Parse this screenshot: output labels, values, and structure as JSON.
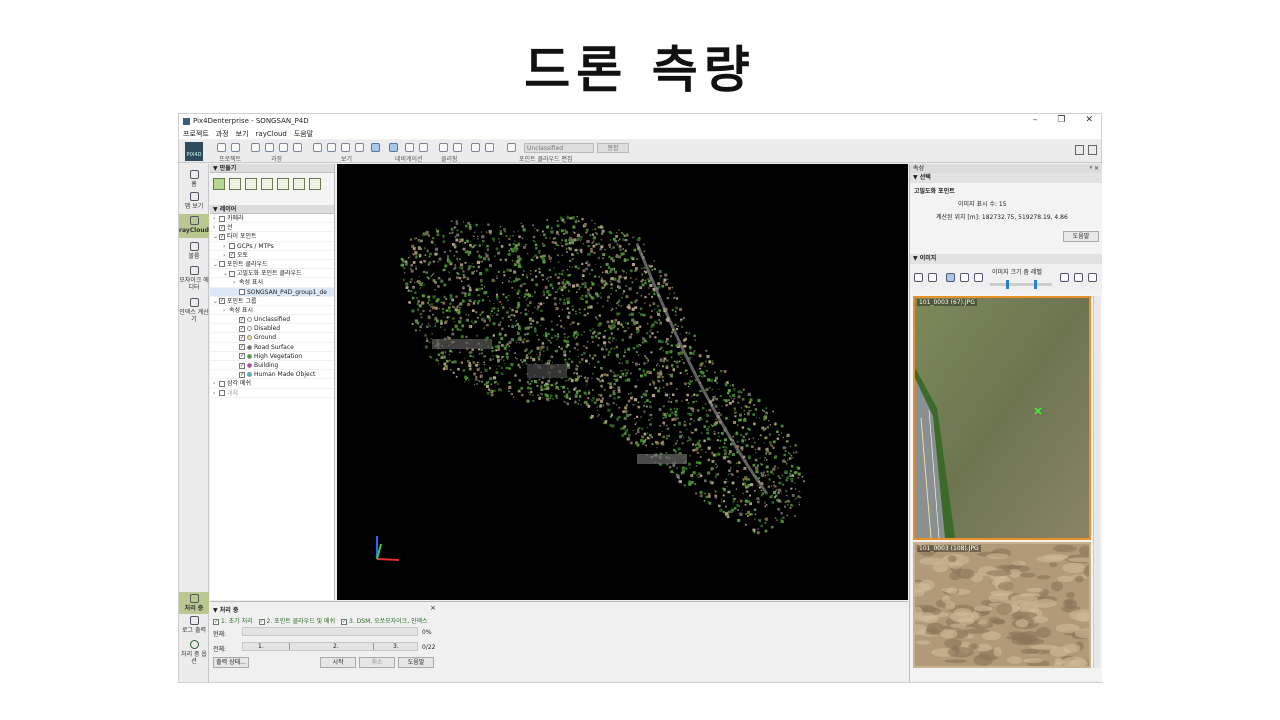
{
  "slide": {
    "title": "드론 측량"
  },
  "window": {
    "title": "Pix4Denterprise - SONGSAN_P4D",
    "controls": [
      "–",
      "❐",
      "✕"
    ]
  },
  "menu": [
    "프로젝트",
    "과정",
    "보기",
    "rayCloud",
    "도움말"
  ],
  "toolbar": {
    "logo": "PIX4D",
    "groups": [
      "프로젝트",
      "과정",
      "보기",
      "네비게이션",
      "클리핑",
      "포인트 클라우드 편집"
    ],
    "class_select": "Unclassified",
    "apply_button": "봉합"
  },
  "rail": [
    {
      "label": "홈",
      "icon": "home-icon"
    },
    {
      "label": "맵 보기",
      "icon": "map-icon"
    },
    {
      "label": "rayCloud",
      "icon": "raycloud-icon"
    },
    {
      "label": "볼륨",
      "icon": "volume-icon"
    },
    {
      "label": "모자이크 에디터",
      "icon": "mosaic-icon"
    },
    {
      "label": "인덱스 계산기",
      "icon": "index-calculator-icon"
    },
    {
      "label": "처리 중",
      "icon": "processing-icon"
    },
    {
      "label": "로그 출력",
      "icon": "log-icon"
    },
    {
      "label": "처리 중 옵션",
      "icon": "gear-icon"
    }
  ],
  "left_panel": {
    "create_header": "만들기",
    "layers_header": "레이어",
    "layers": [
      {
        "label": "카메라",
        "checked": false,
        "indent": 0,
        "arrow": "›"
      },
      {
        "label": "선",
        "checked": true,
        "indent": 0,
        "arrow": "›"
      },
      {
        "label": "타이 포인트",
        "checked": true,
        "indent": 0,
        "arrow": "⌄"
      },
      {
        "label": "GCPs / MTPs",
        "checked": false,
        "indent": 1,
        "arrow": "›"
      },
      {
        "label": "오토",
        "checked": true,
        "indent": 1,
        "arrow": "›"
      },
      {
        "label": "포인트 클라우드",
        "checked": false,
        "indent": 0,
        "arrow": "⌄"
      },
      {
        "label": "고밀도화 포인트 클라우드",
        "checked": false,
        "indent": 1,
        "arrow": "⌄"
      },
      {
        "label": "속성 표시",
        "checked": null,
        "indent": 2,
        "arrow": "›"
      },
      {
        "label": "SONGSAN_P4D_group1_de",
        "checked": false,
        "indent": 2,
        "arrow": "",
        "selected": true
      },
      {
        "label": "포인트 그룹",
        "checked": true,
        "indent": 0,
        "arrow": "⌄"
      },
      {
        "label": "속성 표시",
        "checked": null,
        "indent": 1,
        "arrow": "›"
      },
      {
        "label": "Unclassified",
        "checked": true,
        "indent": 2,
        "arrow": "",
        "dot": "#ffffff"
      },
      {
        "label": "Disabled",
        "checked": true,
        "indent": 2,
        "arrow": "",
        "dot": "#ffffff"
      },
      {
        "label": "Ground",
        "checked": true,
        "indent": 2,
        "arrow": "",
        "dot": "#f0e68c"
      },
      {
        "label": "Road Surface",
        "checked": true,
        "indent": 2,
        "arrow": "",
        "dot": "#707070"
      },
      {
        "label": "High Vegetation",
        "checked": true,
        "indent": 2,
        "arrow": "",
        "dot": "#2ea82e"
      },
      {
        "label": "Building",
        "checked": true,
        "indent": 2,
        "arrow": "",
        "dot": "#c030c0"
      },
      {
        "label": "Human Made Object",
        "checked": true,
        "indent": 2,
        "arrow": "",
        "dot": "#30c0c0"
      },
      {
        "label": "삼각 메쉬",
        "checked": false,
        "indent": 0,
        "arrow": "›"
      },
      {
        "label": "개체",
        "checked": false,
        "indent": 0,
        "arrow": "›"
      }
    ]
  },
  "right_panel": {
    "header": "속성",
    "section_select": "선택",
    "selected_title": "고밀도화 포인트",
    "image_count_label": "이미지 표시 수:",
    "image_count_value": "15",
    "position_label": "계산된 위치 [m]:",
    "position_value": "182732.75, 519278.19, 4.86",
    "help": "도움말",
    "images_header": "이미지",
    "zoom_label": "이미지 크기 줌 레벨",
    "photo1": "101_0003 (67).JPG",
    "photo2": "101_0003 (108).JPG"
  },
  "bottom_panel": {
    "header": "처리 중",
    "steps": [
      "1. 초기 처리",
      "2. 포인트 클라우드 및 메쉬",
      "3. DSM, 오쏘모자이크, 인덱스"
    ],
    "current_label": "현재:",
    "current_pct": "0%",
    "total_label": "전체:",
    "total_segments": [
      "1.",
      "2.",
      "3."
    ],
    "total_count": "0/22",
    "output_state": "출력 상태...",
    "start": "시작",
    "cancel": "취소",
    "help": "도움말"
  },
  "colors": {
    "accent": "#2a7fd0",
    "vegetation": "#3d8a2a",
    "ground": "#8a7a5a",
    "highlight_border": "#e8902a"
  }
}
